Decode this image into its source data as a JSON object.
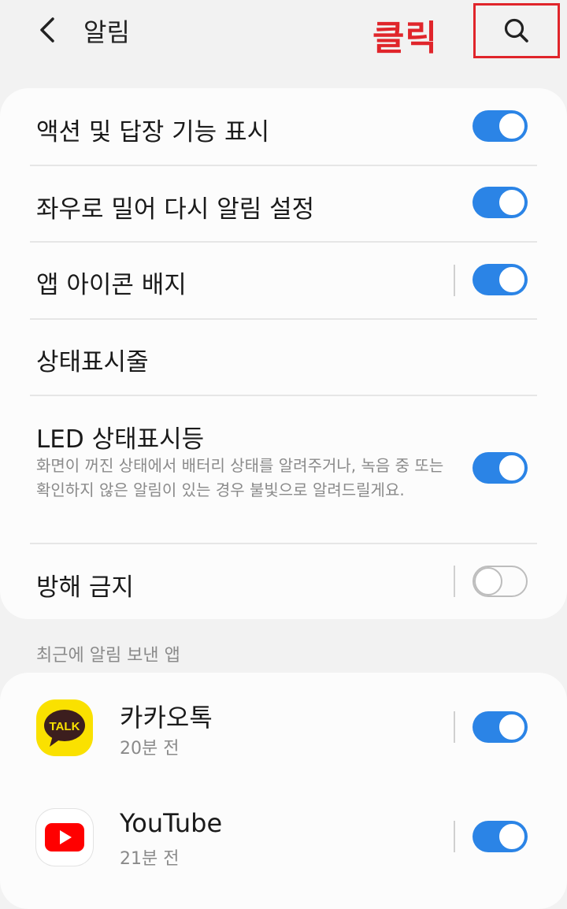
{
  "header": {
    "title": "알림",
    "annotation": "클릭"
  },
  "settings": [
    {
      "label": "액션 및 답장 기능 표시",
      "toggle": "on"
    },
    {
      "label": "좌우로 밀어 다시 알림 설정",
      "toggle": "on"
    },
    {
      "label": "앱 아이콘 배지",
      "toggle": "on"
    },
    {
      "label": "상태표시줄"
    },
    {
      "label": "LED 상태표시등",
      "description": "화면이 꺼진 상태에서 배터리 상태를 알려주거나, 녹음 중 또는 확인하지 않은 알림이 있는 경우 불빛으로 알려드릴게요.",
      "toggle": "on"
    },
    {
      "label": "방해 금지",
      "toggle": "off"
    }
  ],
  "recent_section": {
    "title": "최근에 알림 보낸 앱",
    "apps": [
      {
        "name": "카카오톡",
        "time": "20분 전",
        "icon_text": "TALK",
        "icon": "kakaotalk-icon",
        "toggle": "on"
      },
      {
        "name": "YouTube",
        "time": "21분 전",
        "icon": "youtube-icon",
        "toggle": "on"
      }
    ]
  },
  "colors": {
    "accent": "#2b84e6",
    "annotation": "#e0252b",
    "kakao_yellow": "#fae100",
    "youtube_red": "#ff0000"
  }
}
